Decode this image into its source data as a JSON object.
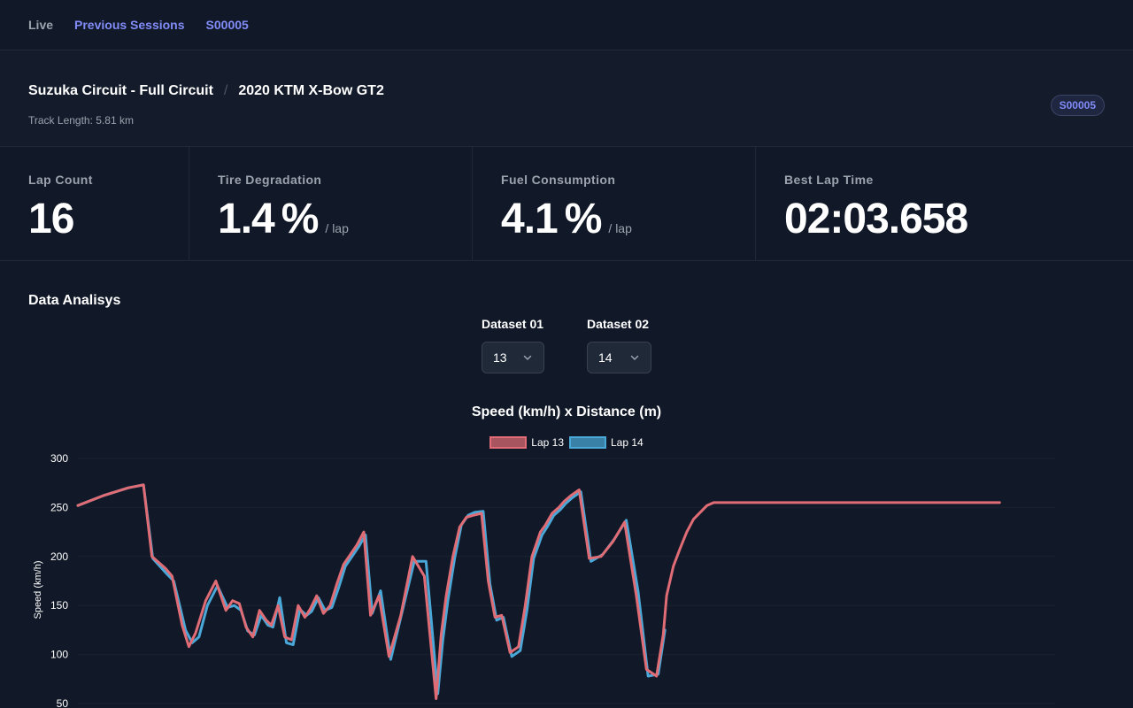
{
  "nav": {
    "live": "Live",
    "previous_sessions": "Previous Sessions",
    "session_id": "S00005"
  },
  "header": {
    "track": "Suzuka Circuit - Full Circuit",
    "separator": "/",
    "car": "2020 KTM X-Bow GT2",
    "track_length": "Track Length: 5.81 km",
    "badge": "S00005"
  },
  "stats": [
    {
      "label": "Lap Count",
      "value": "16",
      "unit": "",
      "per": ""
    },
    {
      "label": "Tire Degradation",
      "value": "1.4",
      "unit": "%",
      "per": "/ lap"
    },
    {
      "label": "Fuel Consumption",
      "value": "4.1",
      "unit": "%",
      "per": "/ lap"
    },
    {
      "label": "Best Lap Time",
      "value": "02:03.658",
      "unit": "",
      "per": ""
    }
  ],
  "analysis": {
    "title": "Data Analisys",
    "dataset1": {
      "label": "Dataset 01",
      "value": "13"
    },
    "dataset2": {
      "label": "Dataset 02",
      "value": "14"
    }
  },
  "colors": {
    "lap13": "#e06c75",
    "lap14": "#4aa8d8",
    "accent": "#818cf8"
  },
  "chart_data": {
    "type": "line",
    "title": "Speed (km/h) x Distance (m)",
    "ylabel": "Speed (km/h)",
    "xlabel": "",
    "ylim": [
      50,
      300
    ],
    "yticks": [
      300,
      250,
      200,
      150,
      100,
      50
    ],
    "grid": true,
    "legend": "top-center",
    "xlim": [
      0,
      5810
    ],
    "series": [
      {
        "name": "Lap 13",
        "x": [
          0,
          150,
          300,
          390,
          440,
          520,
          560,
          620,
          660,
          700,
          760,
          820,
          880,
          920,
          960,
          1000,
          1040,
          1080,
          1120,
          1150,
          1190,
          1230,
          1270,
          1310,
          1350,
          1380,
          1420,
          1460,
          1500,
          1540,
          1580,
          1620,
          1660,
          1700,
          1740,
          1790,
          1850,
          1920,
          1990,
          2060,
          2130,
          2160,
          2190,
          2230,
          2270,
          2310,
          2350,
          2400,
          2440,
          2480,
          2520,
          2570,
          2620,
          2660,
          2700,
          2750,
          2780,
          2820,
          2860,
          2890,
          2930,
          2980,
          3040,
          3110,
          3180,
          3250,
          3320,
          3380,
          3440,
          3480,
          3500,
          3540,
          3580,
          3620,
          3660,
          3700,
          3740,
          3780,
          3820,
          3860,
          3920,
          4000,
          4100,
          4200,
          4300,
          4400,
          4440,
          4480,
          4540,
          4620,
          4700,
          4770,
          4800,
          4830,
          4860,
          4900,
          4940,
          4980,
          5020,
          5060,
          5120,
          5200,
          5280,
          5360,
          5420,
          5480
        ],
        "y": [
          252,
          262,
          270,
          273,
          200,
          188,
          180,
          130,
          108,
          122,
          155,
          175,
          145,
          155,
          152,
          128,
          118,
          145,
          135,
          130,
          150,
          118,
          115,
          150,
          138,
          146,
          160,
          142,
          150,
          172,
          192,
          202,
          212,
          225,
          140,
          160,
          98,
          140,
          200,
          180,
          55,
          120,
          160,
          200,
          230,
          240,
          242,
          244,
          175,
          138,
          140,
          102,
          108,
          150,
          200,
          225,
          232,
          244,
          250,
          256,
          262,
          268,
          198,
          200,
          215,
          235,
          160,
          85,
          78,
          120,
          160,
          190,
          208,
          225,
          238,
          245,
          252,
          255,
          255,
          255,
          255,
          255,
          255,
          255,
          255,
          255,
          255,
          255,
          255,
          255,
          255,
          255,
          255,
          255,
          255,
          255,
          255,
          255,
          255,
          255,
          255,
          255,
          255,
          255,
          255,
          255
        ]
      },
      {
        "name": "Lap 14",
        "x": [
          0,
          150,
          300,
          390,
          445,
          530,
          570,
          640,
          680,
          720,
          770,
          830,
          890,
          930,
          970,
          1010,
          1050,
          1090,
          1130,
          1160,
          1200,
          1240,
          1280,
          1320,
          1360,
          1390,
          1430,
          1470,
          1510,
          1550,
          1590,
          1630,
          1670,
          1710,
          1750,
          1800,
          1860,
          1930,
          2000,
          2070,
          2140,
          2170,
          2200,
          2240,
          2280,
          2320,
          2360,
          2410,
          2450,
          2490,
          2530,
          2580,
          2630,
          2670,
          2710,
          2760,
          2790,
          2830,
          2870,
          2900,
          2940,
          2990,
          3050,
          3120,
          3190,
          3260,
          3330,
          3390,
          3450,
          3490
        ],
        "y": [
          252,
          262,
          270,
          273,
          198,
          182,
          175,
          125,
          112,
          118,
          150,
          170,
          148,
          150,
          145,
          124,
          120,
          140,
          130,
          128,
          158,
          112,
          110,
          146,
          140,
          144,
          158,
          145,
          148,
          168,
          190,
          200,
          210,
          222,
          142,
          165,
          95,
          145,
          195,
          195,
          60,
          115,
          155,
          198,
          232,
          242,
          245,
          246,
          172,
          135,
          138,
          98,
          104,
          145,
          198,
          222,
          230,
          242,
          248,
          254,
          260,
          266,
          195,
          202,
          218,
          237,
          165,
          78,
          80,
          125
        ]
      }
    ]
  }
}
